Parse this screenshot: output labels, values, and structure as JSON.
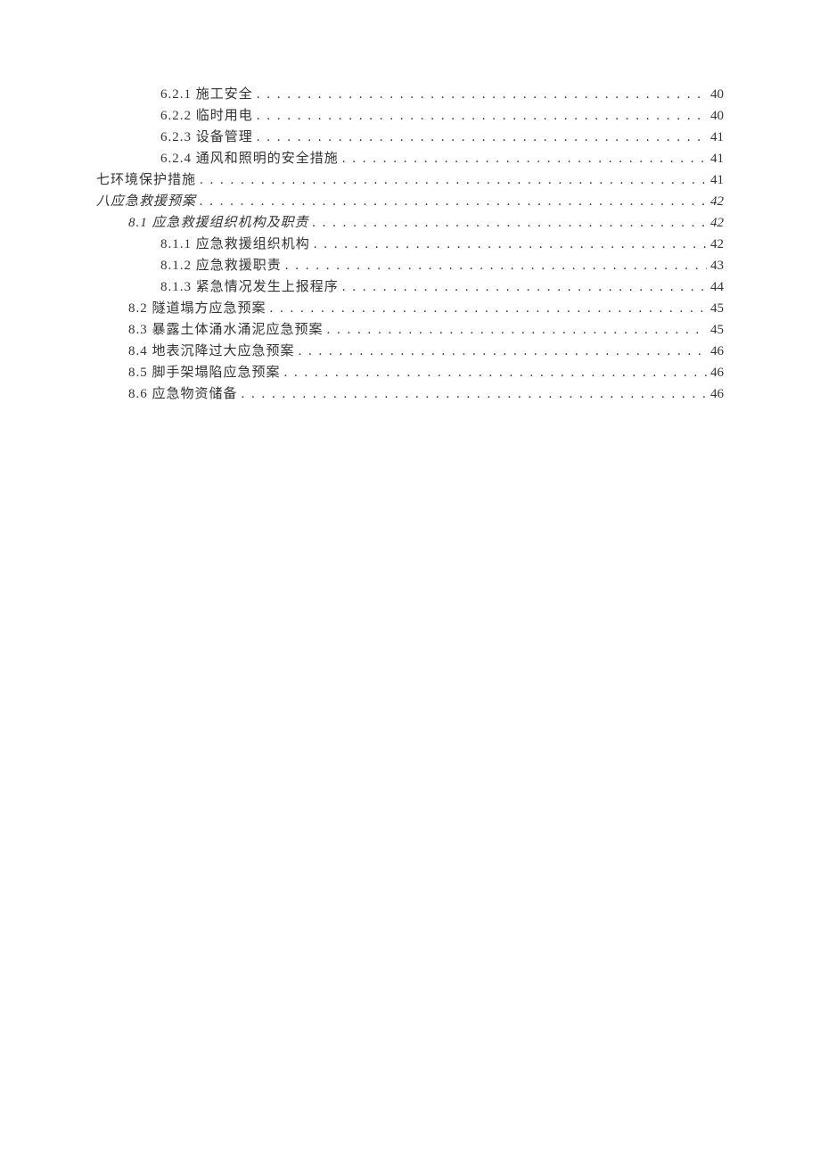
{
  "toc": [
    {
      "level": 3,
      "label": "6.2.1 施工安全",
      "page": "40",
      "italic": false
    },
    {
      "level": 3,
      "label": "6.2.2 临时用电",
      "page": "40",
      "italic": false
    },
    {
      "level": 3,
      "label": "6.2.3 设备管理",
      "page": "41",
      "italic": false
    },
    {
      "level": 3,
      "label": "6.2.4 通风和照明的安全措施",
      "page": "41",
      "italic": false
    },
    {
      "level": 1,
      "label": "七环境保护措施",
      "page": "41",
      "italic": false
    },
    {
      "level": 1,
      "label": "八应急救援预案",
      "page": "42",
      "italic": true
    },
    {
      "level": 2,
      "label": "8.1 应急救援组织机构及职责",
      "page": "42",
      "italic": true
    },
    {
      "level": 3,
      "label": "8.1.1 应急救援组织机构",
      "page": "42",
      "italic": false
    },
    {
      "level": 3,
      "label": "8.1.2 应急救援职责",
      "page": "43",
      "italic": false
    },
    {
      "level": 3,
      "label": "8.1.3 紧急情况发生上报程序",
      "page": "44",
      "italic": false
    },
    {
      "level": 2,
      "label": "8.2 隧道塌方应急预案",
      "page": "45",
      "italic": false
    },
    {
      "level": 2,
      "label": "8.3 暴露土体涌水涌泥应急预案",
      "page": "45",
      "italic": false
    },
    {
      "level": 2,
      "label": "8.4 地表沉降过大应急预案",
      "page": "46",
      "italic": false
    },
    {
      "level": 2,
      "label": "8.5 脚手架塌陷应急预案",
      "page": "46",
      "italic": false
    },
    {
      "level": 2,
      "label": "8.6 应急物资储备",
      "page": "46",
      "italic": false
    }
  ]
}
